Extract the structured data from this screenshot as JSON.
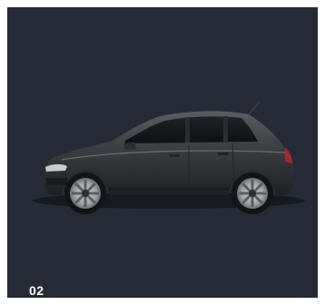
{
  "card": {
    "number": "02",
    "image": "car-side-view",
    "background_color": "#252a36",
    "car_color": "#3a3b3d"
  }
}
